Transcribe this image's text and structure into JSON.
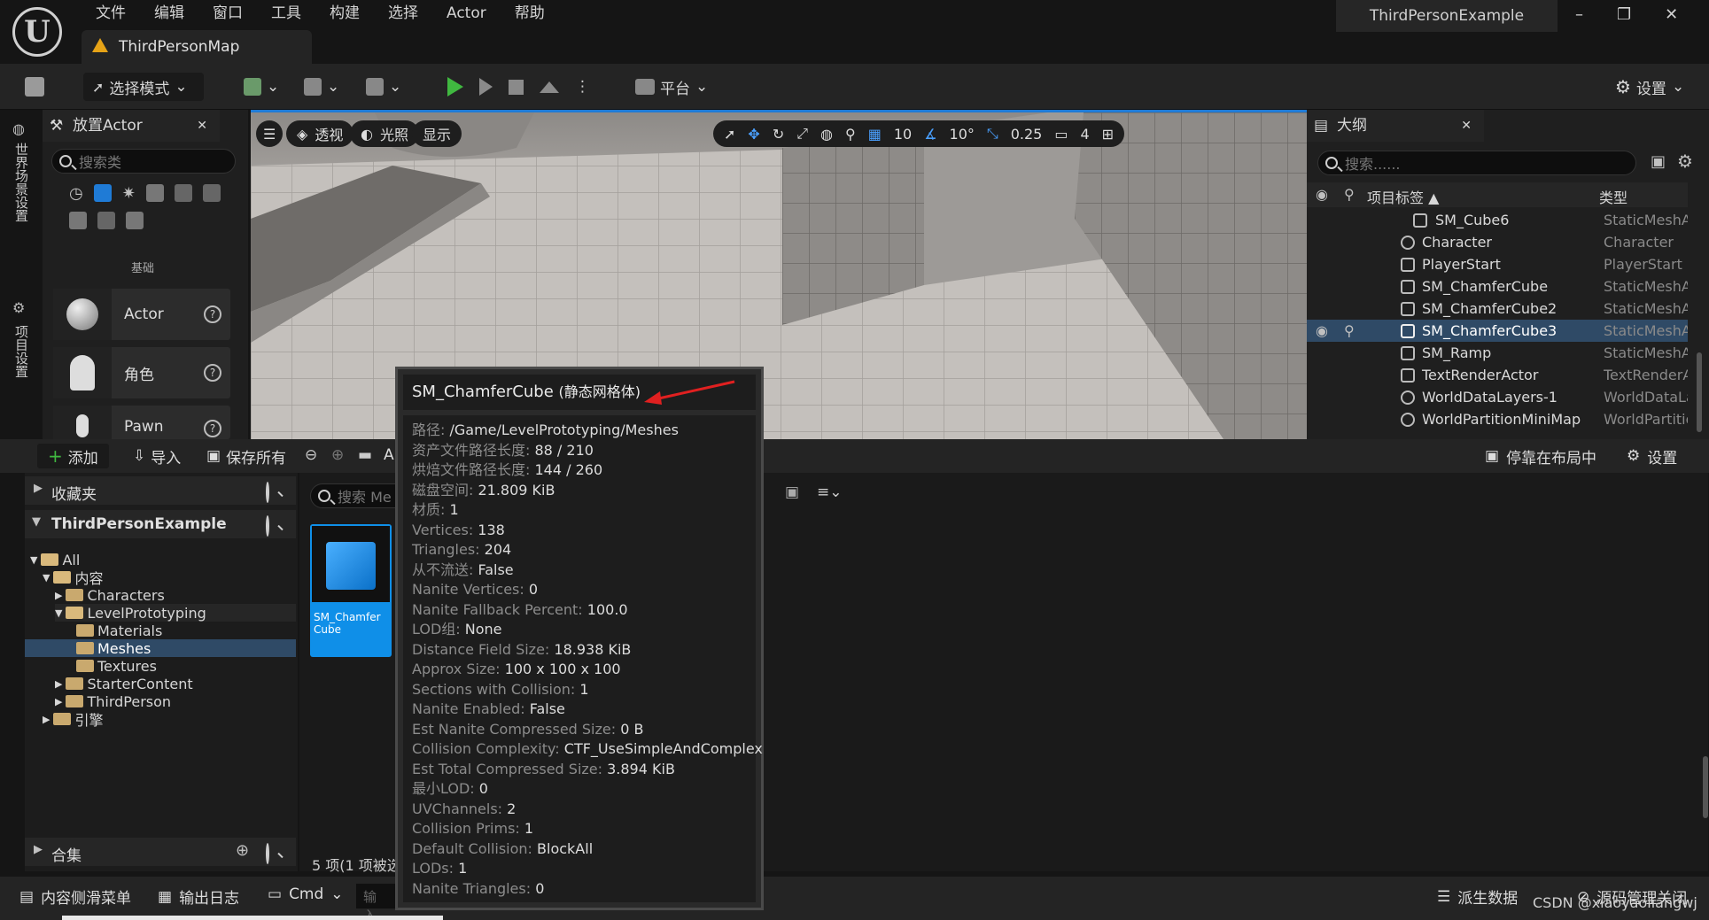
{
  "menu": [
    "文件",
    "编辑",
    "窗口",
    "工具",
    "构建",
    "选择",
    "Actor",
    "帮助"
  ],
  "map_tab": "ThirdPersonMap",
  "project_name": "ThirdPersonExample",
  "window_controls": {
    "minimize": "–",
    "restore": "❐",
    "close": "✕"
  },
  "toolbar": {
    "mode_label": "选择模式",
    "platform_label": "平台",
    "settings_label": "设置"
  },
  "left_strip": {
    "world_settings": "世界场景设置",
    "project_settings": "项目设置"
  },
  "place_actors": {
    "title": "放置Actor",
    "close": "✕",
    "search_placeholder": "搜索类",
    "category_label": "基础",
    "items": [
      {
        "label": "Actor"
      },
      {
        "label": "角色"
      },
      {
        "label": "Pawn"
      }
    ]
  },
  "viewport": {
    "perspective": "透视",
    "lighting": "光照",
    "show": "显示",
    "grid_snap": "10",
    "rot_snap": "10°",
    "scale_snap": "0.25",
    "camera_speed": "4"
  },
  "outliner": {
    "title": "大纲",
    "close": "✕",
    "search_placeholder": "搜索......",
    "col_label": "项目标签 ▲",
    "col_type": "类型",
    "rows": [
      {
        "name": "SM_Cube6",
        "type": "StaticMeshA"
      },
      {
        "name": "Character",
        "type": "Character"
      },
      {
        "name": "PlayerStart",
        "type": "PlayerStart"
      },
      {
        "name": "SM_ChamferCube",
        "type": "StaticMeshA"
      },
      {
        "name": "SM_ChamferCube2",
        "type": "StaticMeshA"
      },
      {
        "name": "SM_ChamferCube3",
        "type": "StaticMeshA"
      },
      {
        "name": "SM_Ramp",
        "type": "StaticMeshA"
      },
      {
        "name": "TextRenderActor",
        "type": "TextRenderA"
      },
      {
        "name": "WorldDataLayers-1",
        "type": "WorldDataLa"
      },
      {
        "name": "WorldPartitionMiniMap",
        "type": "WorldPartitio"
      }
    ]
  },
  "content_browser": {
    "add": "添加",
    "import": "导入",
    "save_all": "保存所有",
    "path_start": "A",
    "dock": "停靠在布局中",
    "settings": "设置",
    "favorites": "收藏夹",
    "project": "ThirdPersonExample",
    "tree": [
      {
        "label": "All"
      },
      {
        "label": "内容"
      },
      {
        "label": "Characters"
      },
      {
        "label": "LevelPrototyping"
      },
      {
        "label": "Materials"
      },
      {
        "label": "Meshes"
      },
      {
        "label": "Textures"
      },
      {
        "label": "StarterContent"
      },
      {
        "label": "ThirdPerson"
      },
      {
        "label": "引擎"
      }
    ],
    "collections": "合集",
    "search_placeholder": "搜索 Me",
    "asset_name": "SM_Chamfer Cube",
    "item_count": "5 项(1 项被选"
  },
  "statusbar": {
    "content_drawer": "内容侧滑菜单",
    "output_log": "输出日志",
    "cmd": "Cmd",
    "console_placeholder": "输入",
    "derived_data": "派生数据",
    "source_control": "源码管理关闭",
    "watermark": "CSDN @xiaoyaoliangwj"
  },
  "tooltip": {
    "title": "SM_ChamferCube",
    "subtitle": "(静态网格体)",
    "lines": [
      {
        "k": "路径: ",
        "v": "/Game/LevelPrototyping/Meshes"
      },
      {
        "k": "资产文件路径长度: ",
        "v": "88 / 210"
      },
      {
        "k": "烘焙文件路径长度: ",
        "v": "144 / 260"
      },
      {
        "k": "磁盘空间: ",
        "v": "21.809 KiB"
      },
      {
        "k": "材质: ",
        "v": "1"
      },
      {
        "k": "Vertices: ",
        "v": "138"
      },
      {
        "k": "Triangles: ",
        "v": "204"
      },
      {
        "k": "从不流送: ",
        "v": "False"
      },
      {
        "k": "Nanite Vertices: ",
        "v": "0"
      },
      {
        "k": "Nanite Fallback Percent: ",
        "v": "100.0"
      },
      {
        "k": "LOD组: ",
        "v": "None"
      },
      {
        "k": "Distance Field Size: ",
        "v": "18.938 KiB"
      },
      {
        "k": "Approx Size: ",
        "v": "100 x 100 x 100"
      },
      {
        "k": "Sections with Collision: ",
        "v": "1"
      },
      {
        "k": "Nanite Enabled: ",
        "v": "False"
      },
      {
        "k": "Est Nanite Compressed Size: ",
        "v": "0 B"
      },
      {
        "k": "Collision Complexity: ",
        "v": "CTF_UseSimpleAndComplex"
      },
      {
        "k": "Est Total Compressed Size: ",
        "v": "3.894 KiB"
      },
      {
        "k": "最小LOD: ",
        "v": "0"
      },
      {
        "k": "UVChannels: ",
        "v": "2"
      },
      {
        "k": "Collision Prims: ",
        "v": "1"
      },
      {
        "k": "Default Collision: ",
        "v": "BlockAll"
      },
      {
        "k": "LODs: ",
        "v": "1"
      },
      {
        "k": "Nanite Triangles: ",
        "v": "0"
      }
    ]
  },
  "colors": {
    "accent": "#1f7bd6",
    "selection": "#2f4a66",
    "play": "#40b840",
    "arrow": "#e02020"
  }
}
